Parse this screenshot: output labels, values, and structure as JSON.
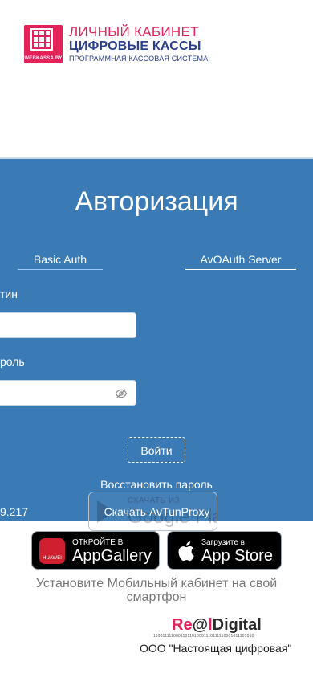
{
  "brand": {
    "logo_caption": "WEBKASSA.BY",
    "line1": "ЛИЧНЫЙ КАБИНЕТ",
    "line2": "ЦИФРОВЫЕ КАССЫ",
    "line3": "ПРОГРАММНАЯ КАССОВАЯ СИСТЕМА",
    "accent_color": "#e3225a",
    "brand_blue": "#2a3f8f"
  },
  "auth": {
    "title": "Авторизация",
    "tabs": [
      {
        "label": "Basic Auth",
        "active": true
      },
      {
        "label": "AvOAuth Server",
        "active": false
      }
    ],
    "login_label": "тин",
    "login_value": "",
    "password_label": "роль",
    "password_value": "",
    "password_toggle_icon": "eye-off-icon",
    "login_button": "Войти",
    "restore_link": "Восстановить пароль",
    "ip_fragment": "9.217",
    "tunproxy_link": "Скачать AvTunProxy",
    "panel_color": "#3a7ab5"
  },
  "stores": {
    "google_play": {
      "small": "СКАЧАТЬ ИЗ",
      "big": "Google Play"
    },
    "huawei": {
      "icon_caption": "HUAWEI",
      "small": "ОТКРОЙТЕ В",
      "big": "AppGallery"
    },
    "apple": {
      "small": "Загрузите в",
      "big": "App Store"
    }
  },
  "install_text": "Установите Мобильный кабинет на свой смартфон",
  "footer": {
    "logo_part1": "Re",
    "logo_mark": "@",
    "logo_part2": "l",
    "logo_part3": "Digital",
    "code": "11001111100011011010001110111110001011101010",
    "company": "ООО \"Настоящая цифровая\""
  }
}
